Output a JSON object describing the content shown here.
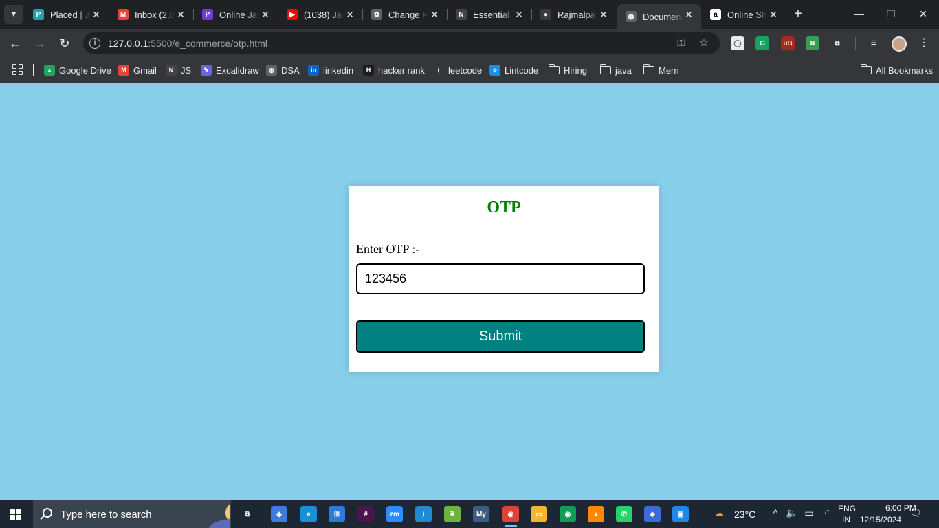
{
  "browser": {
    "tabs": [
      {
        "title": "Placed | Jo",
        "favicon": "placed-icon",
        "color": "#1fa3a8",
        "glyph": "P",
        "active": false
      },
      {
        "title": "Inbox (2,0",
        "favicon": "gmail-icon",
        "color": "#ea4335",
        "glyph": "M",
        "active": false
      },
      {
        "title": "Online Jav",
        "favicon": "online-java-icon",
        "color": "#6b3fd6",
        "glyph": "P",
        "active": false
      },
      {
        "title": "(1038) Jav",
        "favicon": "youtube-icon",
        "color": "#ff0000",
        "glyph": "▶",
        "active": false
      },
      {
        "title": "Change F",
        "favicon": "chatgpt-icon",
        "color": "#5f6368",
        "glyph": "✿",
        "active": false
      },
      {
        "title": "Essential J",
        "favicon": "notion-icon",
        "color": "#444444",
        "glyph": "N",
        "active": false
      },
      {
        "title": "Rajmalpa",
        "favicon": "github-icon",
        "color": "#3a3a3a",
        "glyph": "●",
        "active": false
      },
      {
        "title": "Documen",
        "favicon": "globe-icon",
        "color": "#5f6368",
        "glyph": "◍",
        "active": true
      },
      {
        "title": "Online Sh",
        "favicon": "amazon-icon",
        "color": "#ffffff",
        "glyph": "a",
        "active": false
      }
    ],
    "tab_close": "✕",
    "new_tab": "+",
    "window_controls": {
      "minimize": "—",
      "restore": "❐",
      "close": "✕"
    },
    "nav": {
      "back": "←",
      "forward": "→",
      "reload": "↻"
    },
    "url_host": "127.0.0.1",
    "url_path": ":5500/e_commerce/otp.html",
    "omnibox_icons": {
      "password": "⚿",
      "star": "☆"
    },
    "extensions": [
      {
        "name": "highlighter-extension-icon",
        "color": "#e8eaed",
        "glyph": "◯"
      },
      {
        "name": "grammarly-icon",
        "color": "#15a362",
        "glyph": "G"
      },
      {
        "name": "ublock-icon",
        "color": "#a52a1e",
        "glyph": "uB"
      },
      {
        "name": "email-extension-icon",
        "color": "#3a9b55",
        "glyph": "✉"
      },
      {
        "name": "puzzle-extensions-icon",
        "color": "#35363a",
        "glyph": "⧉"
      }
    ],
    "media_glyph": "≡",
    "menu_glyph": "⋮",
    "bookmarks": [
      {
        "label": "Google Drive",
        "icon": "google-drive-icon",
        "color": "#1fa463",
        "glyph": "▲",
        "folder": false
      },
      {
        "label": "Gmail",
        "icon": "gmail-icon",
        "color": "#ea4335",
        "glyph": "M",
        "folder": false
      },
      {
        "label": "JS",
        "icon": "notion-icon",
        "color": "#444444",
        "glyph": "N",
        "folder": false
      },
      {
        "label": "Excalidraw",
        "icon": "excalidraw-icon",
        "color": "#6965db",
        "glyph": "✎",
        "folder": false
      },
      {
        "label": "DSA",
        "icon": "globe-icon",
        "color": "#5f6368",
        "glyph": "◍",
        "folder": false
      },
      {
        "label": "linkedin",
        "icon": "linkedin-icon",
        "color": "#0a66c2",
        "glyph": "in",
        "folder": false
      },
      {
        "label": "hacker rank",
        "icon": "hackerrank-icon",
        "color": "#1b1b1b",
        "glyph": "H",
        "folder": false
      },
      {
        "label": "leetcode",
        "icon": "leetcode-icon",
        "color": "#35363a",
        "glyph": "⟨",
        "folder": false
      },
      {
        "label": "Lintcode",
        "icon": "lintcode-icon",
        "color": "#1b8ce8",
        "glyph": "⟡",
        "folder": false
      },
      {
        "label": "Hiring",
        "icon": "folder-icon",
        "folder": true
      },
      {
        "label": "java",
        "icon": "folder-icon",
        "folder": true
      },
      {
        "label": "Mern",
        "icon": "folder-icon",
        "folder": true
      }
    ],
    "all_bookmarks": "All Bookmarks"
  },
  "page": {
    "background": "#87ceeb",
    "title": "OTP",
    "title_color": "#008000",
    "label": "Enter OTP :-",
    "otp_value": "123456",
    "submit_label": "Submit",
    "submit_color": "#008080"
  },
  "taskbar": {
    "search_placeholder": "Type here to search",
    "apps": [
      {
        "name": "task-view-icon",
        "color": "#1c2733",
        "glyph": "⧉"
      },
      {
        "name": "copilot-icon",
        "color": "#3d7be0",
        "glyph": "◆"
      },
      {
        "name": "edge-icon",
        "color": "#1a8fd6",
        "glyph": "e"
      },
      {
        "name": "microsoft-store-icon",
        "color": "#2f7ad8",
        "glyph": "⊞"
      },
      {
        "name": "slack-icon",
        "color": "#4a154b",
        "glyph": "#"
      },
      {
        "name": "zoom-icon",
        "color": "#2d8cff",
        "glyph": "zm"
      },
      {
        "name": "vscode-icon",
        "color": "#1f8ad2",
        "glyph": "⟩"
      },
      {
        "name": "spring-icon",
        "color": "#6db33f",
        "glyph": "❦"
      },
      {
        "name": "mysql-workbench-icon",
        "color": "#3e5b80",
        "glyph": "My"
      },
      {
        "name": "chrome-icon",
        "color": "#db4437",
        "glyph": "◉"
      },
      {
        "name": "file-explorer-icon",
        "color": "#f2b630",
        "glyph": "▭"
      },
      {
        "name": "chrome-profile-icon",
        "color": "#0f9d58",
        "glyph": "◉"
      },
      {
        "name": "vlc-icon",
        "color": "#ff8800",
        "glyph": "▲"
      },
      {
        "name": "whatsapp-icon",
        "color": "#25d366",
        "glyph": "✆"
      },
      {
        "name": "git-icon",
        "color": "#3b6bd6",
        "glyph": "◈"
      },
      {
        "name": "photos-icon",
        "color": "#1e88e5",
        "glyph": "▣"
      }
    ],
    "weather_temp": "23°C",
    "lang_top": "ENG",
    "lang_bottom": "IN",
    "time": "6:00 PM",
    "date": "12/15/2024"
  }
}
